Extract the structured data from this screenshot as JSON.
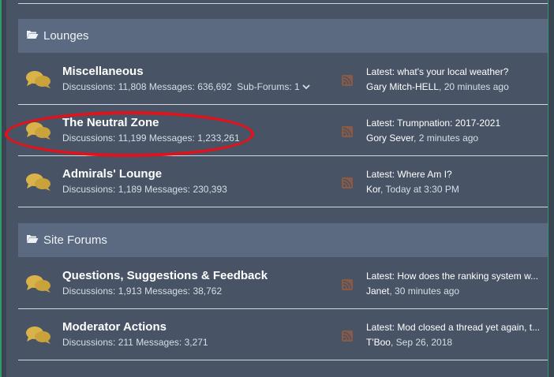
{
  "categories": [
    {
      "title": "Lounges",
      "forums": [
        {
          "title": "Miscellaneous",
          "discussions": "11,808",
          "messages": "636,692",
          "subforums_label": "Sub-Forums:",
          "subforums_count": "1",
          "latest": "Latest: what's your local weather?",
          "user": "Gary Mitch-HELL",
          "time": "20 minutes ago"
        },
        {
          "title": "The Neutral Zone",
          "discussions": "11,199",
          "messages": "1,233,261",
          "latest": "Latest: Trumpnation: 2017-2021",
          "user": "Gory Sever",
          "time": "2 minutes ago"
        },
        {
          "title": "Admirals' Lounge",
          "discussions": "1,189",
          "messages": "230,393",
          "latest": "Latest: Where Am I?",
          "user": "Kor",
          "time": "Today at 3:30 PM"
        }
      ]
    },
    {
      "title": "Site Forums",
      "forums": [
        {
          "title": "Questions, Suggestions & Feedback",
          "discussions": "1,913",
          "messages": "38,762",
          "latest": "Latest: How does the ranking system w...",
          "user": "Janet",
          "time": "30 minutes ago"
        },
        {
          "title": "Moderator Actions",
          "discussions": "211",
          "messages": "3,271",
          "latest": "Latest: Mod closed a thread yet again, t...",
          "user": "T'Boo",
          "time": "Sep 26, 2018"
        }
      ]
    }
  ],
  "labels": {
    "discussions": "Discussions:",
    "messages": "Messages:",
    "separator": ", "
  },
  "colors": {
    "panel": "#485465",
    "category_header": "#5b6a80",
    "chat_icon": "#d9b24a",
    "rss_icon": "#8a5a45",
    "highlight": "#e0121b"
  }
}
